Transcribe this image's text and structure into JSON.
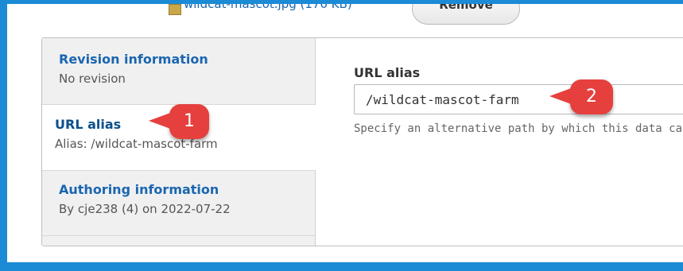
{
  "top": {
    "file_link": "wildcat-mascot.jpg (170 KB)",
    "remove_label": "Remove"
  },
  "tabs": [
    {
      "title": "Revision information",
      "summary": "No revision"
    },
    {
      "title": "URL alias",
      "summary": "Alias: /wildcat-mascot-farm"
    },
    {
      "title": "Authoring information",
      "summary": "By cje238 (4) on 2022-07-22"
    }
  ],
  "pane": {
    "label": "URL alias",
    "value": "/wildcat-mascot-farm",
    "description": "Specify an alternative path by which this data can be accessed."
  },
  "callouts": [
    "1",
    "2"
  ],
  "colors": {
    "frame": "#1b8bd6",
    "link": "#1a66b0",
    "callout": "#e5403d"
  }
}
